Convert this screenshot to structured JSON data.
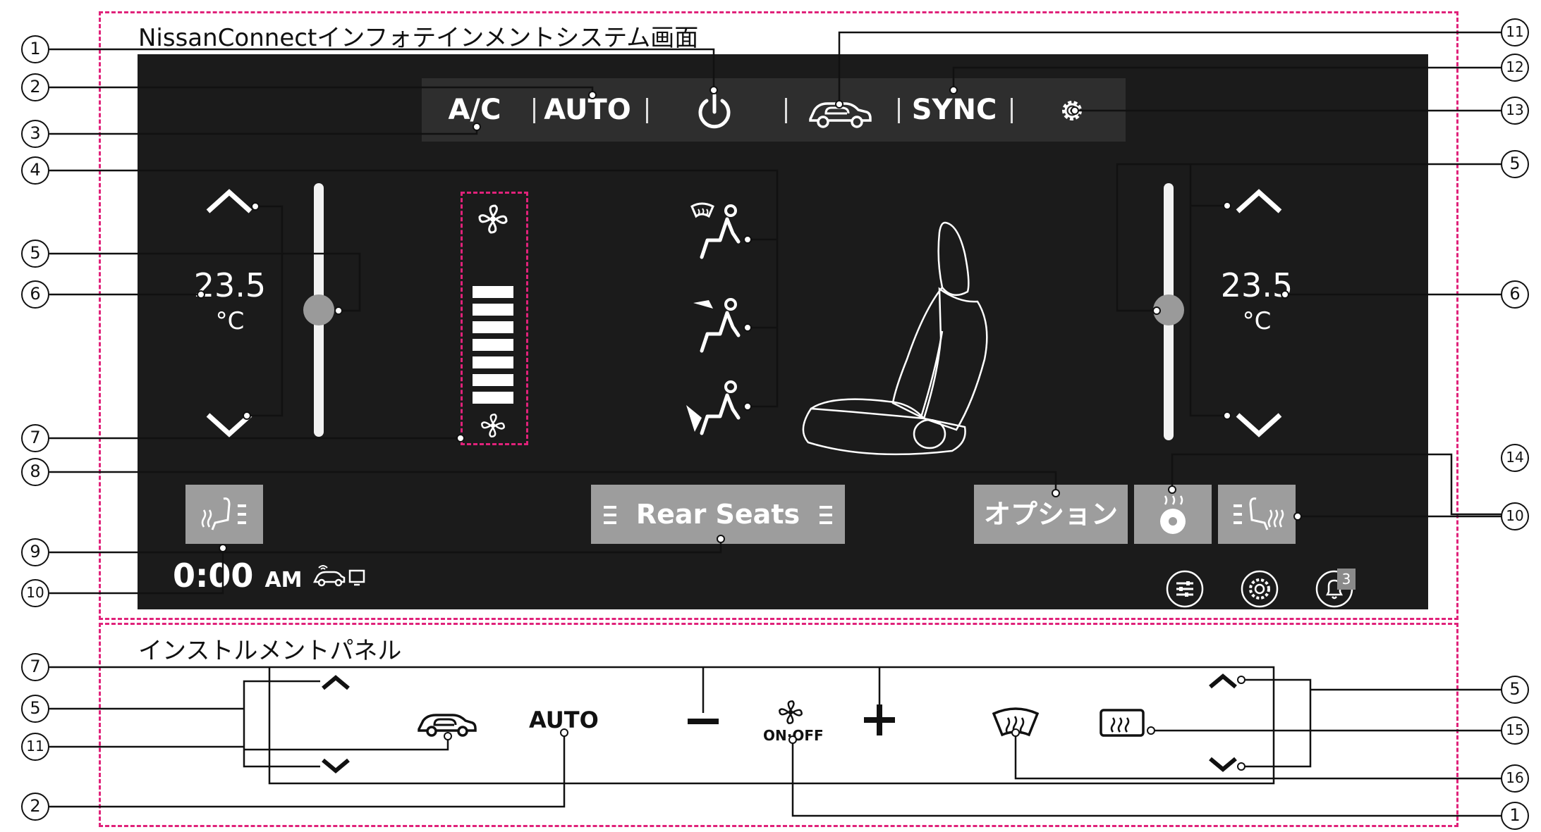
{
  "titles": {
    "infotainment": "NissanConnectインフォテインメントシステム画面",
    "instrument_panel": "インストルメントパネル"
  },
  "screen": {
    "topbar": {
      "ac_label": "A/C",
      "auto_label": "AUTO",
      "sync_label": "SYNC"
    },
    "temp_left": {
      "value": "23.5",
      "unit": "°C"
    },
    "temp_right": {
      "value": "23.5",
      "unit": "°C"
    },
    "fan_level": 7,
    "buttons": {
      "rear_seats": "Rear Seats",
      "options": "オプション"
    },
    "status": {
      "clock": "0:00",
      "ampm": "AM",
      "notification_count": "3"
    }
  },
  "panel": {
    "auto_label": "AUTO",
    "fan_switch_label": "ON·OFF"
  },
  "callouts": [
    "1",
    "2",
    "3",
    "4",
    "5",
    "6",
    "7",
    "8",
    "9",
    "10",
    "11",
    "12",
    "13",
    "14",
    "15",
    "16"
  ],
  "icons": [
    "power-icon",
    "recirculation-icon",
    "settings-icon",
    "fan-icon",
    "airflow-defrost-icon",
    "airflow-face-icon",
    "airflow-foot-icon",
    "seat-illustration",
    "seat-heater-icon",
    "steering-heater-icon",
    "rear-defroster-icon",
    "front-defroster-icon",
    "climate-menu-icon",
    "bell-icon"
  ],
  "colors": {
    "highlight_dashes": "#e0227a",
    "screen_bg": "#1b1b1b",
    "button_gray": "#9d9d9d"
  }
}
